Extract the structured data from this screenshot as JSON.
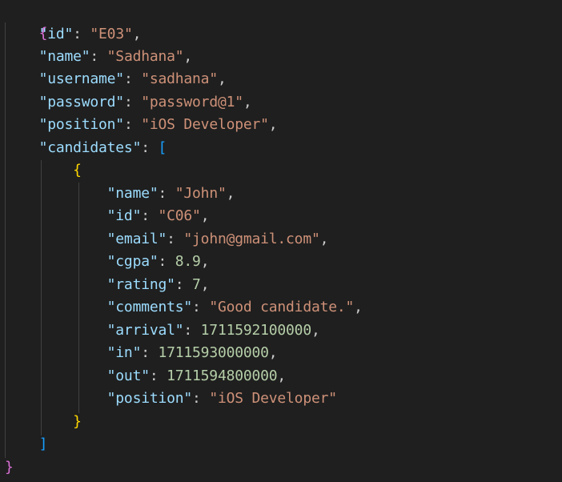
{
  "editor": {
    "language": "json",
    "theme_colors": {
      "background": "#1f1f1f",
      "key": "#9cdcfe",
      "string": "#ce9178",
      "number": "#b5cea8",
      "outer_brace": "#da70d6",
      "bracket": "#179fff",
      "inner_brace": "#ffd700"
    },
    "root": {
      "open": "{",
      "close": "}",
      "fields": [
        {
          "key": "\"id\"",
          "value": "\"E03\"",
          "type": "string"
        },
        {
          "key": "\"name\"",
          "value": "\"Sadhana\"",
          "type": "string"
        },
        {
          "key": "\"username\"",
          "value": "\"sadhana\"",
          "type": "string"
        },
        {
          "key": "\"password\"",
          "value": "\"password@1\"",
          "type": "string"
        },
        {
          "key": "\"position\"",
          "value": "\"iOS Developer\"",
          "type": "string"
        }
      ],
      "candidates_key": "\"candidates\"",
      "candidates_open": "[",
      "candidates_close": "]",
      "candidate": {
        "open": "{",
        "close": "}",
        "fields": [
          {
            "key": "\"name\"",
            "value": "\"John\"",
            "type": "string"
          },
          {
            "key": "\"id\"",
            "value": "\"C06\"",
            "type": "string"
          },
          {
            "key": "\"email\"",
            "value": "\"john@gmail.com\"",
            "type": "string"
          },
          {
            "key": "\"cgpa\"",
            "value": "8.9",
            "type": "number"
          },
          {
            "key": "\"rating\"",
            "value": "7",
            "type": "number"
          },
          {
            "key": "\"comments\"",
            "value": "\"Good candidate.\"",
            "type": "string"
          },
          {
            "key": "\"arrival\"",
            "value": "1711592100000",
            "type": "number"
          },
          {
            "key": "\"in\"",
            "value": "1711593000000",
            "type": "number"
          },
          {
            "key": "\"out\"",
            "value": "1711594800000",
            "type": "number"
          },
          {
            "key": "\"position\"",
            "value": "\"iOS Developer\"",
            "type": "string"
          }
        ]
      }
    }
  }
}
